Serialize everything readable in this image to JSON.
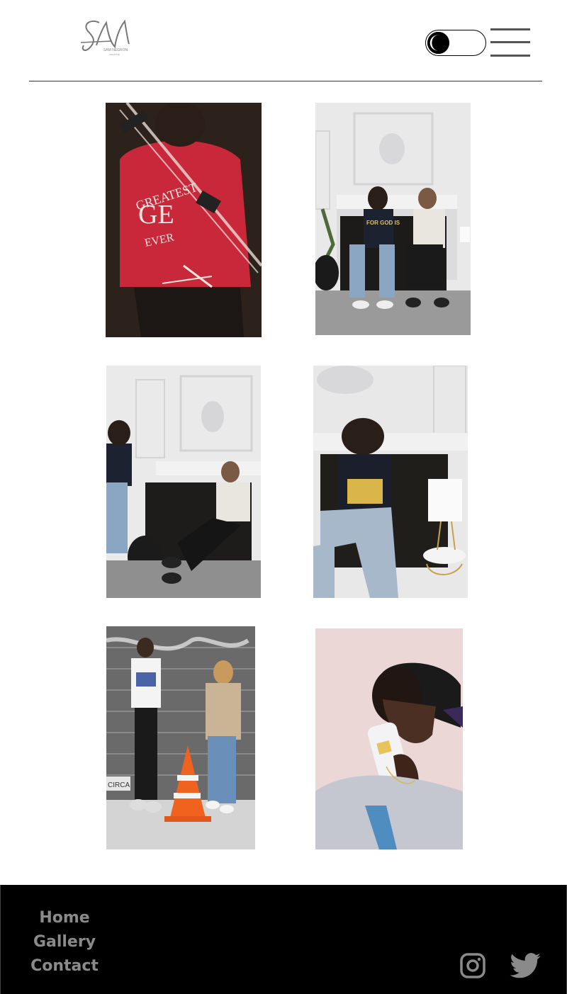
{
  "header": {
    "logo": {
      "initials": "SN",
      "name_line": "SAM NEGRON",
      "sub_line": "CREATIVE",
      "icon": "logo-signature"
    },
    "theme_toggle": {
      "icon": "moon-icon",
      "state": "off"
    },
    "menu": {
      "icon": "hamburger-icon"
    }
  },
  "gallery": {
    "photos": [
      {
        "id": "photo-1",
        "description_icon": "image"
      },
      {
        "id": "photo-2",
        "description_icon": "image"
      },
      {
        "id": "photo-3",
        "description_icon": "image"
      },
      {
        "id": "photo-4",
        "description_icon": "image"
      },
      {
        "id": "photo-5",
        "description_icon": "image"
      },
      {
        "id": "photo-6",
        "description_icon": "image"
      }
    ],
    "photo_1_print": {
      "line1": "GREATEST",
      "mark": "GE",
      "line2": "EVER"
    },
    "photo_2_shirt": "FOR GOD IS",
    "photo_5_sign": "CIRCA"
  },
  "footer": {
    "nav": [
      "Home",
      "Gallery",
      "Contact"
    ],
    "social": [
      {
        "icon": "instagram-icon"
      },
      {
        "icon": "twitter-icon"
      }
    ]
  },
  "colors": {
    "background": "#ffffff",
    "footer_bg": "#000000",
    "footer_text": "#8a8a8a",
    "accent_red": "#c8283a"
  }
}
